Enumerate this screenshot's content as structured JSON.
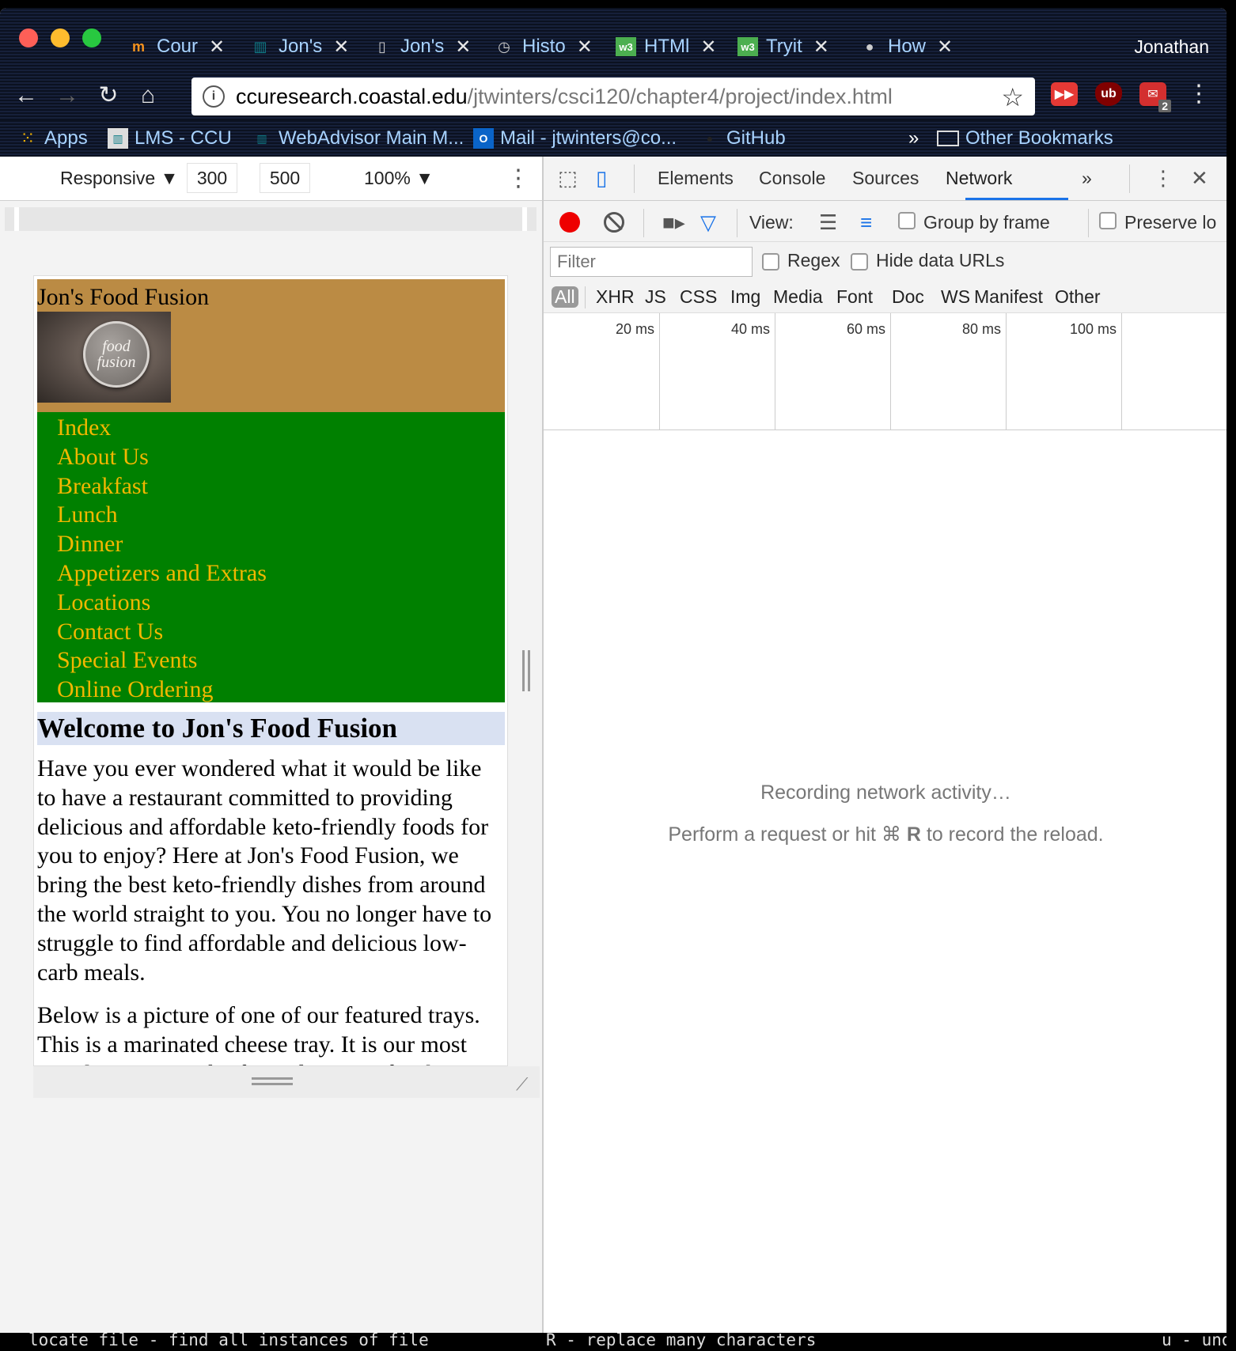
{
  "window": {
    "tabs": [
      {
        "label": "Cour",
        "icon": "moodle-icon"
      },
      {
        "label": "Jon's",
        "icon": "ccu-icon"
      },
      {
        "label": "Jon's",
        "icon": "document-icon"
      },
      {
        "label": "Histo",
        "icon": "history-icon"
      },
      {
        "label": "HTMl",
        "icon": "w3schools-icon"
      },
      {
        "label": "Tryit",
        "icon": "w3schools-icon"
      },
      {
        "label": "How",
        "icon": "apple-icon"
      }
    ],
    "profile_name": "Jonathan"
  },
  "toolbar": {
    "url_host": "ccuresearch.coastal.edu",
    "url_path": "/jtwinters/csci120/chapter4/project/index.html",
    "ext_badge": "2"
  },
  "bookmarks": {
    "items": [
      {
        "label": "Apps"
      },
      {
        "label": "LMS - CCU"
      },
      {
        "label": "WebAdvisor Main M..."
      },
      {
        "label": "Mail - jtwinters@co..."
      },
      {
        "label": "GitHub"
      }
    ],
    "overflow": "»",
    "other": "Other Bookmarks"
  },
  "device_toolbar": {
    "mode": "Responsive",
    "width": "300",
    "height": "500",
    "times": "×",
    "zoom": "100%"
  },
  "site": {
    "title": "Jon's Food Fusion",
    "logo_line1": "food",
    "logo_line2": "fusion",
    "nav": [
      "Index",
      "About Us",
      "Breakfast",
      "Lunch",
      "Dinner",
      "Appetizers and Extras",
      "Locations",
      "Contact Us",
      "Special Events",
      "Online Ordering"
    ],
    "heading": "Welcome to Jon's Food Fusion",
    "paragraph1": "Have you ever wondered what it would be like to have a restaurant committed to providing delicious and affordable keto-friendly foods for you to enjoy? Here at Jon's Food Fusion, we bring the best keto-friendly dishes from around the world straight to you. You no longer have to struggle to find affordable and delicious low-carb meals.",
    "paragraph2": "Below is a picture of one of our featured trays. This is a marinated cheese tray. It is our most popular appetizer by far and is great for the"
  },
  "devtools": {
    "tabs": [
      "Elements",
      "Console",
      "Sources",
      "Network"
    ],
    "active_tab": "Network",
    "more": "»",
    "view_label": "View:",
    "group_by_frame": "Group by frame",
    "preserve_log": "Preserve lo",
    "filter_placeholder": "Filter",
    "regex": "Regex",
    "hide_data_urls": "Hide data URLs",
    "types": [
      "All",
      "XHR",
      "JS",
      "CSS",
      "Img",
      "Media",
      "Font",
      "Doc",
      "WS",
      "Manifest",
      "Other"
    ],
    "timeline_ticks": [
      "20 ms",
      "40 ms",
      "60 ms",
      "80 ms",
      "100 ms"
    ],
    "msg_recording": "Recording network activity…",
    "msg_perform_pre": "Perform a request or hit ⌘ ",
    "msg_perform_key": "R",
    "msg_perform_post": " to record the reload."
  },
  "terminal": {
    "left_text": "locate file - find all instances of file",
    "mid_text": "R - replace many characters",
    "right_text": "u - und"
  },
  "colors": {
    "header_bg": "#bb8b44",
    "nav_bg": "#008000",
    "nav_link": "#f2b700",
    "heading_bg": "#d9e1f2",
    "record_red": "#ee0000",
    "active_tab_underline": "#1a73e8"
  }
}
